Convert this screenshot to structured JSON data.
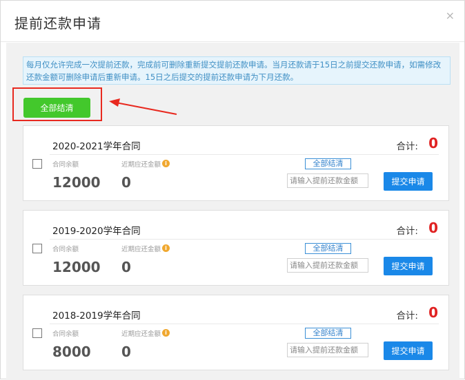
{
  "dialog": {
    "title": "提前还款申请",
    "close_glyph": "×"
  },
  "notice": "每月仅允许完成一次提前还款，完成前可删除重新提交提前还款申请。当月还款请于15日之前提交还款申请，如需修改还款金额可删除申请后重新申请。15日之后提交的提前还款申请为下月还款。",
  "toolbar": {
    "all_settle_label": "全部结清",
    "highlight_color": "#e8291f"
  },
  "labels": {
    "balance": "合同余额",
    "due": "近期应还金额",
    "total": "合计:",
    "settle": "全部结清",
    "amount_placeholder": "请输入提前还款金额",
    "submit": "提交申请",
    "info_glyph": "i"
  },
  "contracts": [
    {
      "title": "2020-2021学年合同",
      "balance": "12000",
      "due": "0",
      "total": "0"
    },
    {
      "title": "2019-2020学年合同",
      "balance": "12000",
      "due": "0",
      "total": "0"
    },
    {
      "title": "2018-2019学年合同",
      "balance": "8000",
      "due": "0",
      "total": "0"
    }
  ],
  "colors": {
    "accent_green": "#43c82c",
    "accent_blue": "#1a88e8",
    "total_red": "#e02222"
  }
}
